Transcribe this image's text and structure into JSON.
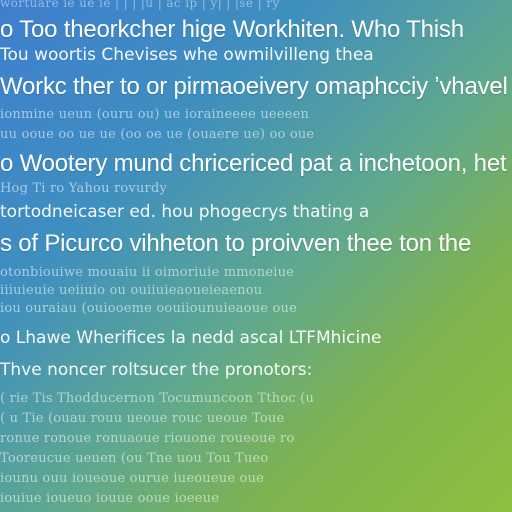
{
  "lines": [
    "wortuare  ie ue   ie   | |    | |u    | ac     ip |  y|   | |se |  ry",
    "o  Too theorkcher hige Workhiten. Who Thish",
    "  Tou woortis Chevises  whe owmilvilleng thea",
    "  Workc ther to or pirmaoeivery omaphcciy ʼvhavel",
    "  ionmine  ueun    (ouru ou)  ue  ioraineeee ueeeen",
    "   uu ooue  oo ue ue (oo oe ue  (ouaere ue) oo oue",
    "o  Wootery mund chricericed pat a inchetoon, het",
    "  Hog      Ti    ro   Yahou    rovurdy",
    "   tortodneicaser  ed.  hou phogecrys thating a",
    "s  of Picurco vihheton to proivven thee ton the",
    "     otonbiouiwe mouaiu ii  oimoriuie  mmoneiue",
    "   iiiuieuie    ueiiuio  ou  ouiiuieaoueieaenou",
    "   iou ouraiau  (ouiooeme  oouiiounuieaoue oue",
    "o  Lhawe Wherifices la nedd ascal LTFMhicine",
    "   Thve noncer roltsucer the pronotors:",
    "    (  rie  Tis  Thodducernon  Tocumuncoon  Tthoc (u",
    "    ( u Tie  (ouau  rouu  ueoue  rouc  ueoue  Toue",
    "     ronue  ronoue  ronuaoue  riouone  roueoue  ro",
    "      Tooreucue  ueuen (ou  Tne uou  Tou  Tueo",
    "     iounu  ouu   ioueoue  ourue  iueoueue   oue",
    "       iouiue  ioueuo   iouue   ooue   ioeeue"
  ]
}
